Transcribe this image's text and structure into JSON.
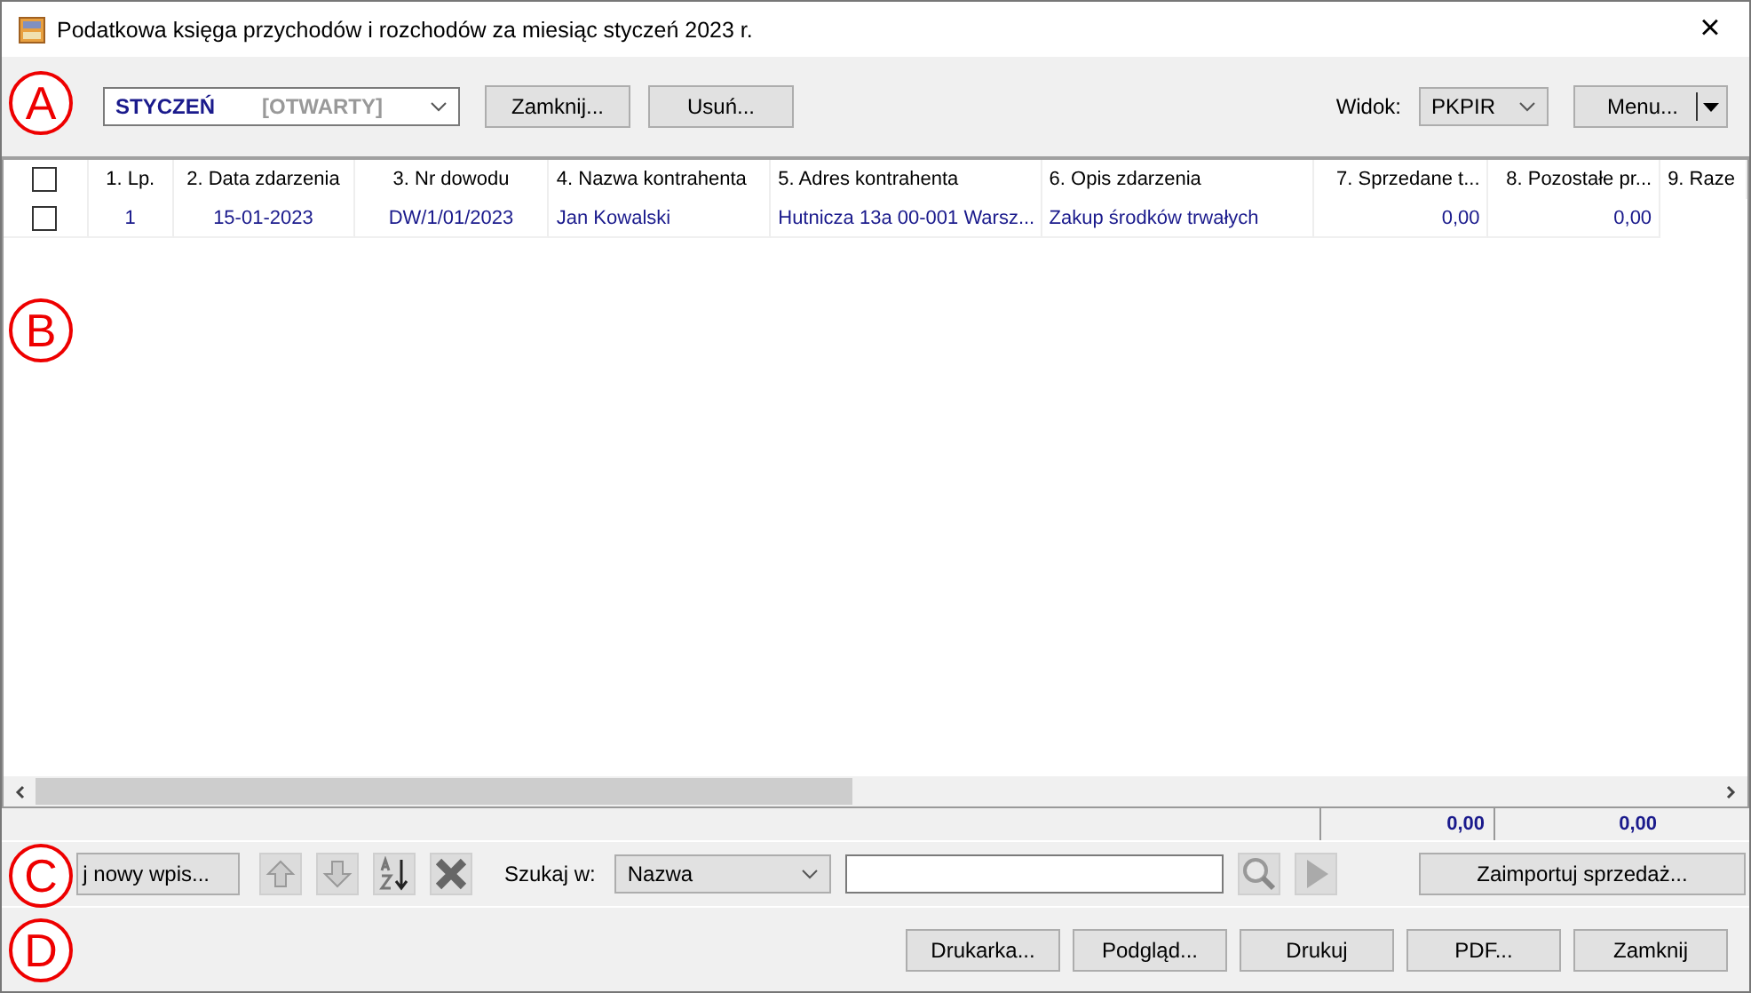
{
  "window": {
    "title": "Podatkowa księga przychodów i rozchodów za miesiąc styczeń 2023 r.",
    "close": "×"
  },
  "period": {
    "month": "STYCZEŃ",
    "status": "[OTWARTY]"
  },
  "period_buttons": [
    "Zamknij...",
    "Usuń..."
  ],
  "view": {
    "label": "Widok:",
    "value": "PKPIR"
  },
  "menu_button": "Menu...",
  "table": {
    "header_checked": false,
    "columns": [
      "1. Lp.",
      "2. Data zdarzenia",
      "3. Nr dowodu",
      "4. Nazwa kontrahenta",
      "5. Adres kontrahenta",
      "6. Opis zdarzenia",
      "7. Sprzedane t...",
      "8. Pozostałe pr...",
      "9. Raze"
    ],
    "rows": [
      {
        "checked": false,
        "cells": [
          "1",
          "15-01-2023",
          "DW/1/01/2023",
          "Jan Kowalski",
          "Hutnicza 13a 00-001 Warsz...",
          "Zakup środków trwałych",
          "0,00",
          "0,00",
          ""
        ]
      }
    ],
    "totals": [
      "0,00",
      "0,00"
    ]
  },
  "add_button": "j nowy wpis...",
  "search": {
    "label": "Szukaj w:",
    "field": "Nazwa"
  },
  "import_button": "Zaimportuj sprzedaż...",
  "footer_buttons": [
    "Drukarka...",
    "Podgląd...",
    "Drukuj",
    "PDF...",
    "Zamknij"
  ],
  "callouts": [
    "A",
    "B",
    "C",
    "D"
  ]
}
